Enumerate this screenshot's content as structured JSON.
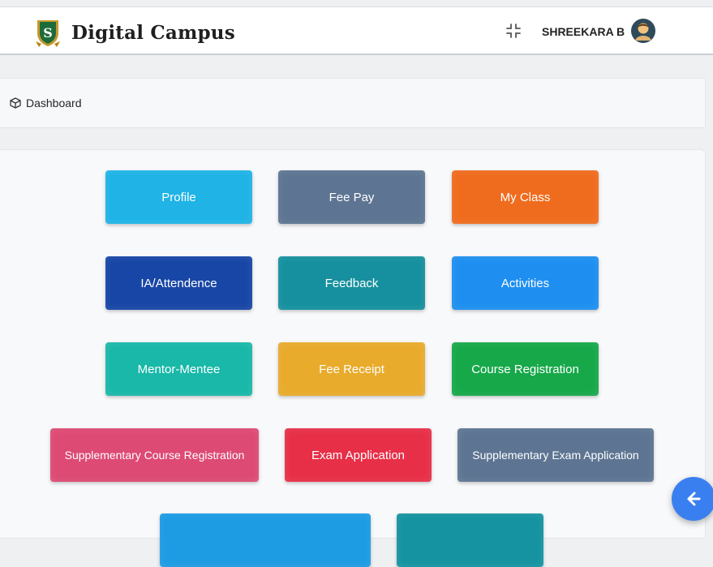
{
  "header": {
    "brand_letter": "S",
    "app_title": "Digital Campus",
    "user_name": "SHREEKARA B",
    "fullscreen_icon": "compress-icon",
    "avatar_icon": "user-avatar"
  },
  "breadcrumb": {
    "icon": "cube-icon",
    "label": "Dashboard"
  },
  "tiles": {
    "profile": "Profile",
    "fee_pay": "Fee Pay",
    "my_class": "My Class",
    "ia_attendence": "IA/Attendence",
    "feedback": "Feedback",
    "activities": "Activities",
    "mentor_mentee": "Mentor-Mentee",
    "fee_receipt": "Fee Receipt",
    "course_registration": "Course Registration",
    "supplementary_course_registration": "Supplementary Course Registration",
    "exam_application": "Exam Application",
    "supplementary_exam_application": "Supplementary Exam Application"
  },
  "colors": {
    "profile": "#1fb3e6",
    "fee_pay": "#5d7592",
    "my_class": "#ef6c1e",
    "ia_attendence": "#1846a6",
    "feedback": "#16909e",
    "activities": "#1e8ff0",
    "mentor_mentee": "#19b8a8",
    "fee_receipt": "#e8ab2c",
    "course_registration": "#17a84a",
    "supplementary_course_registration": "#dd4a74",
    "exam_application": "#e72f48",
    "supplementary_exam_application": "#5d7592",
    "partial_tile_left": "#1d9be3",
    "partial_tile_right": "#1593a0",
    "fab": "#3a7ff0"
  },
  "fab": {
    "icon": "arrow-left-icon"
  }
}
